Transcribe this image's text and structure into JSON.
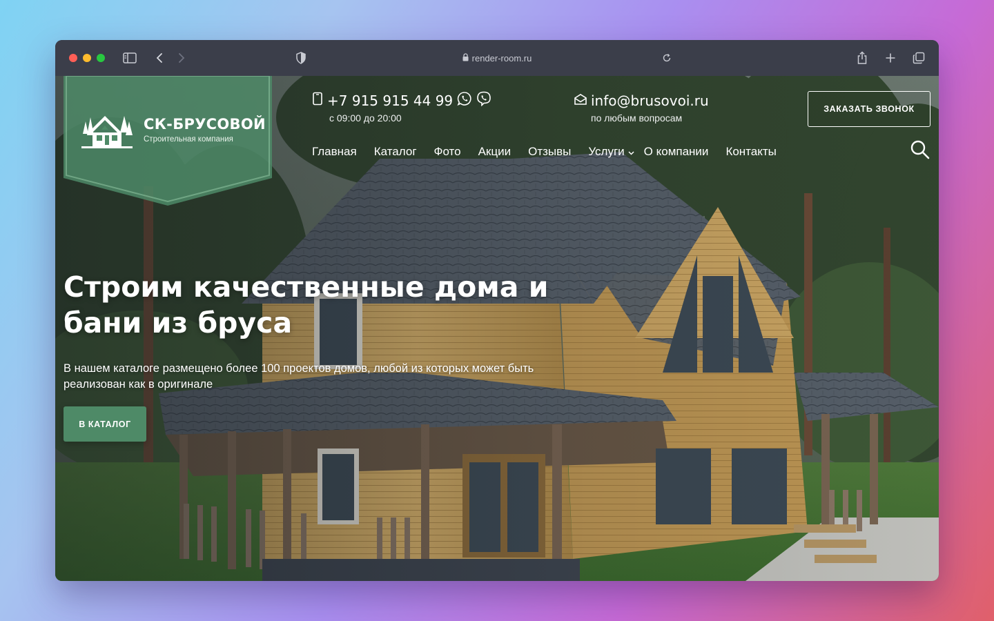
{
  "browser": {
    "url": "render-room.ru",
    "icons": [
      "sidebar-icon",
      "back-icon",
      "forward-icon",
      "shield-icon",
      "lock-icon",
      "reload-icon",
      "share-icon",
      "new-tab-icon",
      "tabs-icon"
    ]
  },
  "brand": {
    "name": "СК-БРУСОВОЙ",
    "tagline": "Строительная компания",
    "badge_color": "#4e8a67"
  },
  "header": {
    "phone": "+7 915 915 44 99",
    "phone_hours": "с 09:00 до 20:00",
    "email": "info@brusovoi.ru",
    "email_note": "по любым вопросам",
    "callback_label": "ЗАКАЗАТЬ ЗВОНОК"
  },
  "nav": {
    "items": [
      {
        "label": "Главная"
      },
      {
        "label": "Каталог"
      },
      {
        "label": "Фото"
      },
      {
        "label": "Акции"
      },
      {
        "label": "Отзывы"
      },
      {
        "label": "Услуги"
      },
      {
        "label": "О компании"
      },
      {
        "label": "Контакты"
      }
    ]
  },
  "hero": {
    "title": "Строим качественные дома и бани из бруса",
    "text": "В нашем каталоге размещено более 100 проектов домов, любой из которых может быть реализован как в оригинале",
    "cta_label": "В КАТАЛОГ",
    "accent_color": "#4e8a67"
  }
}
